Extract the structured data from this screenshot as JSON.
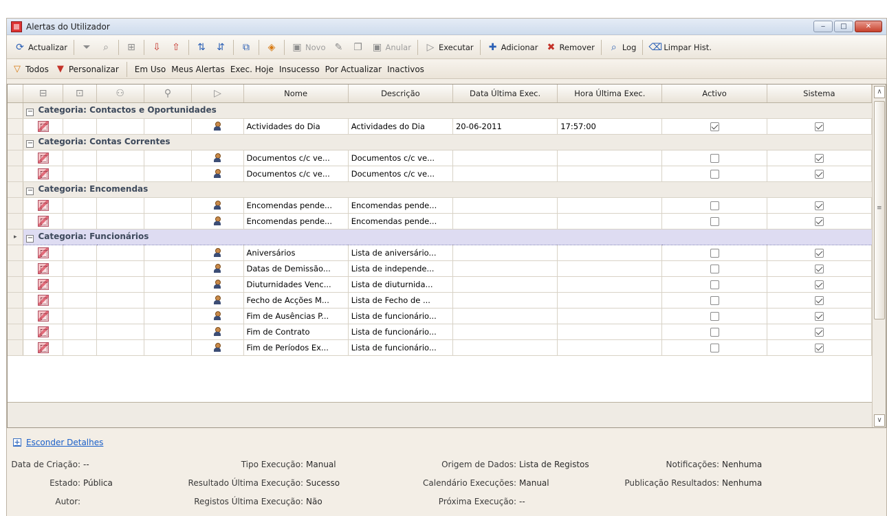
{
  "window": {
    "title": "Alertas do Utilizador",
    "buttons": {
      "minimize": "‒",
      "maximize": "□",
      "close": "✕"
    }
  },
  "toolbar": {
    "refresh": "Actualizar",
    "new": "Novo",
    "cancel": "Anular",
    "execute": "Executar",
    "add": "Adicionar",
    "remove": "Remover",
    "log": "Log",
    "clear_history": "Limpar Hist."
  },
  "filters": {
    "all": "Todos",
    "customize": "Personalizar",
    "in_use": "Em Uso",
    "my_alerts": "Meus Alertas",
    "exec_today": "Exec. Hoje",
    "failure": "Insucesso",
    "to_update": "Por Actualizar",
    "inactive": "Inactivos"
  },
  "grid": {
    "columns": [
      "Nome",
      "Descrição",
      "Data Última Exec.",
      "Hora Última Exec.",
      "Activo",
      "Sistema"
    ],
    "groups": [
      {
        "label": "Categoria: Contactos e Oportunidades",
        "rows": [
          {
            "nome": "Actividades do Dia",
            "descricao": "Actividades do Dia",
            "data": "20-06-2011",
            "hora": "17:57:00",
            "activo": true,
            "sistema": true
          }
        ]
      },
      {
        "label": "Categoria: Contas Correntes",
        "rows": [
          {
            "nome": "Documentos c/c ve...",
            "descricao": "Documentos c/c ve...",
            "data": "",
            "hora": "",
            "activo": false,
            "sistema": true
          },
          {
            "nome": "Documentos c/c ve...",
            "descricao": "Documentos c/c ve...",
            "data": "",
            "hora": "",
            "activo": false,
            "sistema": true
          }
        ]
      },
      {
        "label": "Categoria: Encomendas",
        "rows": [
          {
            "nome": "Encomendas pende...",
            "descricao": "Encomendas pende...",
            "data": "",
            "hora": "",
            "activo": false,
            "sistema": true
          },
          {
            "nome": "Encomendas pende...",
            "descricao": "Encomendas pende...",
            "data": "",
            "hora": "",
            "activo": false,
            "sistema": true
          }
        ]
      },
      {
        "label": "Categoria: Funcionários",
        "current": true,
        "rows": [
          {
            "nome": "Aniversários",
            "descricao": "Lista de aniversário...",
            "data": "",
            "hora": "",
            "activo": false,
            "sistema": true
          },
          {
            "nome": "Datas de Demissão...",
            "descricao": "Lista de independe...",
            "data": "",
            "hora": "",
            "activo": false,
            "sistema": true
          },
          {
            "nome": "Diuturnidades Venc...",
            "descricao": "Lista de diuturnida...",
            "data": "",
            "hora": "",
            "activo": false,
            "sistema": true
          },
          {
            "nome": "Fecho de Acções M...",
            "descricao": "Lista de Fecho de ...",
            "data": "",
            "hora": "",
            "activo": false,
            "sistema": true
          },
          {
            "nome": "Fim de Ausências P...",
            "descricao": "Lista de funcionário...",
            "data": "",
            "hora": "",
            "activo": false,
            "sistema": true
          },
          {
            "nome": "Fim de Contrato",
            "descricao": "Lista de funcionário...",
            "data": "",
            "hora": "",
            "activo": false,
            "sistema": true
          },
          {
            "nome": "Fim de Períodos Ex...",
            "descricao": "Lista de funcionário...",
            "data": "",
            "hora": "",
            "activo": false,
            "sistema": true
          }
        ]
      }
    ]
  },
  "details": {
    "toggle_label": "Esconder Detalhes",
    "fields": {
      "data_criacao_label": "Data de Criação:",
      "data_criacao": "--",
      "estado_label": "Estado:",
      "estado": "Pública",
      "autor_label": "Autor:",
      "autor": "",
      "tipo_exec_label": "Tipo Execução:",
      "tipo_exec": "Manual",
      "resultado_label": "Resultado Última Execução:",
      "resultado": "Sucesso",
      "registos_label": "Registos Última Execução:",
      "registos": "Não",
      "origem_label": "Origem de Dados:",
      "origem": "Lista de Registos",
      "calendario_label": "Calendário Execuções:",
      "calendario": "Manual",
      "proxima_label": "Próxima Execução:",
      "proxima": "--",
      "notificacoes_label": "Notificações:",
      "notificacoes": "Nenhuma",
      "publicacao_label": "Publicação Resultados:",
      "publicacao": "Nenhuma"
    }
  },
  "colors": {
    "accent": "#1a5fc9",
    "current_group": "#dedcf2",
    "group_text": "#3e4a5c"
  }
}
